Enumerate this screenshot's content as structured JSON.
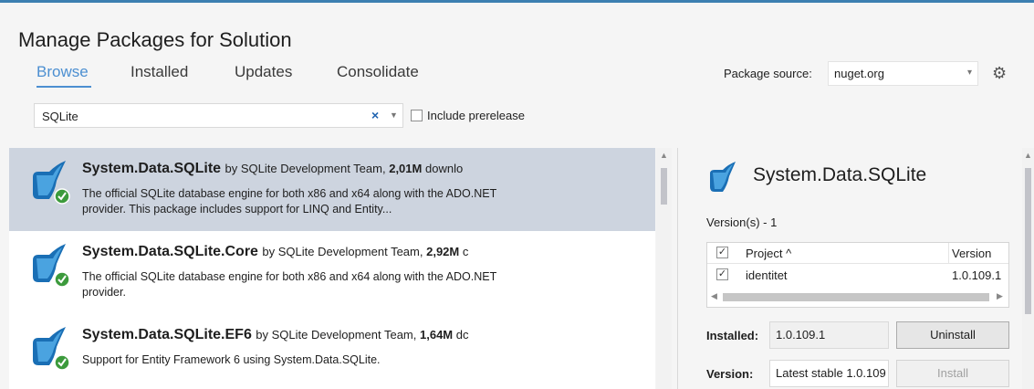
{
  "window": {
    "title": "Manage Packages for Solution"
  },
  "tabs": [
    {
      "label": "Browse",
      "active": true
    },
    {
      "label": "Installed",
      "active": false
    },
    {
      "label": "Updates",
      "active": false
    },
    {
      "label": "Consolidate",
      "active": false
    }
  ],
  "package_source": {
    "label": "Package source:",
    "value": "nuget.org"
  },
  "search": {
    "value": "SQLite",
    "clear_glyph": "×"
  },
  "prerelease": {
    "label": "Include prerelease",
    "checked": false
  },
  "packages": [
    {
      "name": "System.Data.SQLite",
      "author_prefix": "by SQLite Development Team,",
      "downloads": "2,01M",
      "downloads_suffix": "downlo",
      "description": "The official SQLite database engine for both x86 and x64 along with the ADO.NET provider.  This package includes support for LINQ and Entity...",
      "installed": true,
      "selected": true
    },
    {
      "name": "System.Data.SQLite.Core",
      "author_prefix": "by SQLite Development Team,",
      "downloads": "2,92M",
      "downloads_suffix": "c",
      "description": "The official SQLite database engine for both x86 and x64 along with the ADO.NET provider.",
      "installed": true,
      "selected": false
    },
    {
      "name": "System.Data.SQLite.EF6",
      "author_prefix": "by SQLite Development Team,",
      "downloads": "1,64M",
      "downloads_suffix": "dc",
      "description": "Support for Entity Framework 6 using System.Data.SQLite.",
      "installed": true,
      "selected": false
    }
  ],
  "detail": {
    "title": "System.Data.SQLite",
    "versions_label": "Version(s) - 1",
    "table": {
      "col_project": "Project ^",
      "col_version": "Version",
      "rows": [
        {
          "project": "identitet",
          "version": "1.0.109.1",
          "checked": true
        }
      ]
    },
    "installed_label": "Installed:",
    "installed_value": "1.0.109.1",
    "uninstall_label": "Uninstall",
    "version_label": "Version:",
    "version_value": "Latest stable 1.0.109",
    "install_label": "Install"
  },
  "colors": {
    "accent": "#4c8fd1",
    "selected_row": "#cdd4df",
    "check_green": "#3c9a3c",
    "icon_blue": "#1a6fb5"
  },
  "icons": {
    "package": "feather-quill-icon",
    "installed_badge": "check-circle-icon",
    "settings": "gear-icon"
  }
}
